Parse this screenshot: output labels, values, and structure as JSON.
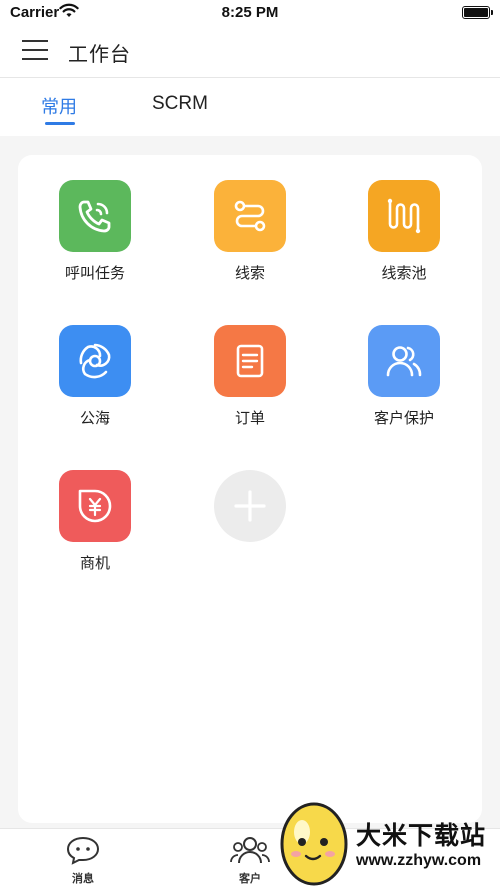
{
  "status_bar": {
    "carrier": "Carrier",
    "time": "8:25 PM",
    "battery_level": 1.0
  },
  "nav": {
    "title": "工作台",
    "menu_icon": "hamburger-menu-icon"
  },
  "tabs": [
    {
      "label": "常用",
      "active": true
    },
    {
      "label": "SCRM",
      "active": false
    }
  ],
  "colors": {
    "accent": "#2f7be5",
    "green": "#5cb85c",
    "orange": "#fbb23a",
    "amber": "#f5a623",
    "blue": "#3d8ef2",
    "coral": "#f57845",
    "sky": "#5b9bf5",
    "red": "#ef5b5b"
  },
  "grid": [
    {
      "label": "呼叫任务",
      "icon": "phone-call-icon"
    },
    {
      "label": "线索",
      "icon": "route-icon"
    },
    {
      "label": "线索池",
      "icon": "pool-icon"
    },
    {
      "label": "公海",
      "icon": "swirl-icon"
    },
    {
      "label": "订单",
      "icon": "document-icon"
    },
    {
      "label": "客户保护",
      "icon": "users-icon"
    },
    {
      "label": "商机",
      "icon": "yen-bag-icon"
    },
    {
      "label": "",
      "icon": "add-icon"
    }
  ],
  "tab_bar": [
    {
      "label": "消息",
      "icon": "chat-bubble-icon"
    },
    {
      "label": "客户",
      "icon": "customers-icon"
    }
  ],
  "watermark": {
    "brand": "大米下载站",
    "url": "www.zzhyw.com"
  }
}
